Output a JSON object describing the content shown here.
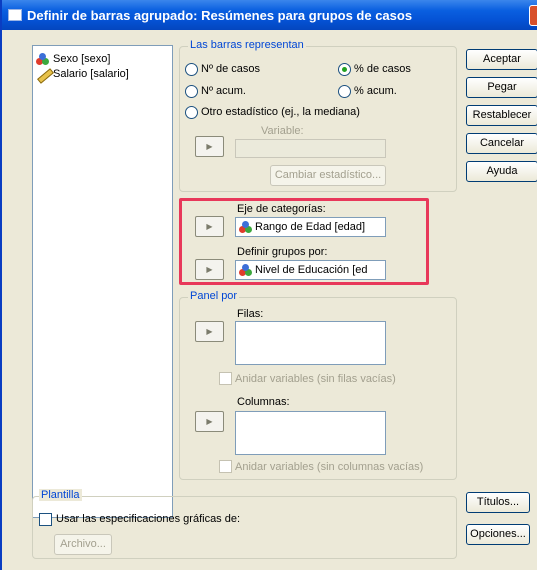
{
  "window": {
    "title": "Definir de barras agrupado: Resúmenes para grupos de casos"
  },
  "variables": [
    {
      "label": "Sexo [sexo]",
      "icon": "nominal-icon"
    },
    {
      "label": "Salario [salario]",
      "icon": "scale-icon"
    }
  ],
  "bars_represent": {
    "legend": "Las barras representan",
    "options": [
      "Nº de casos",
      "% de casos",
      "Nº acum.",
      "% acum.",
      "Otro estadístico (ej., la mediana)"
    ],
    "selected": "% de casos",
    "variable_label": "Variable:",
    "change_stat_button": "Cambiar estadístico..."
  },
  "category_axis": {
    "label": "Eje de categorías:",
    "value": "Rango de Edad [edad]"
  },
  "define_groups": {
    "label": "Definir grupos por:",
    "value": "Nivel de Educación [ed"
  },
  "panel_by": {
    "legend": "Panel por",
    "rows_label": "Filas:",
    "nest_rows": "Anidar variables (sin filas vacías)",
    "columns_label": "Columnas:",
    "nest_columns": "Anidar variables (sin columnas vacías)"
  },
  "template": {
    "legend": "Plantilla",
    "use_spec": "Usar las especificaciones gráficas de:",
    "file_button": "Archivo..."
  },
  "buttons": {
    "ok": "Aceptar",
    "paste": "Pegar",
    "reset": "Restablecer",
    "cancel": "Cancelar",
    "help": "Ayuda",
    "titles": "Títulos...",
    "options": "Opciones..."
  },
  "colors": {
    "highlight": "#e8385a",
    "title_bar": "#0553d6"
  }
}
